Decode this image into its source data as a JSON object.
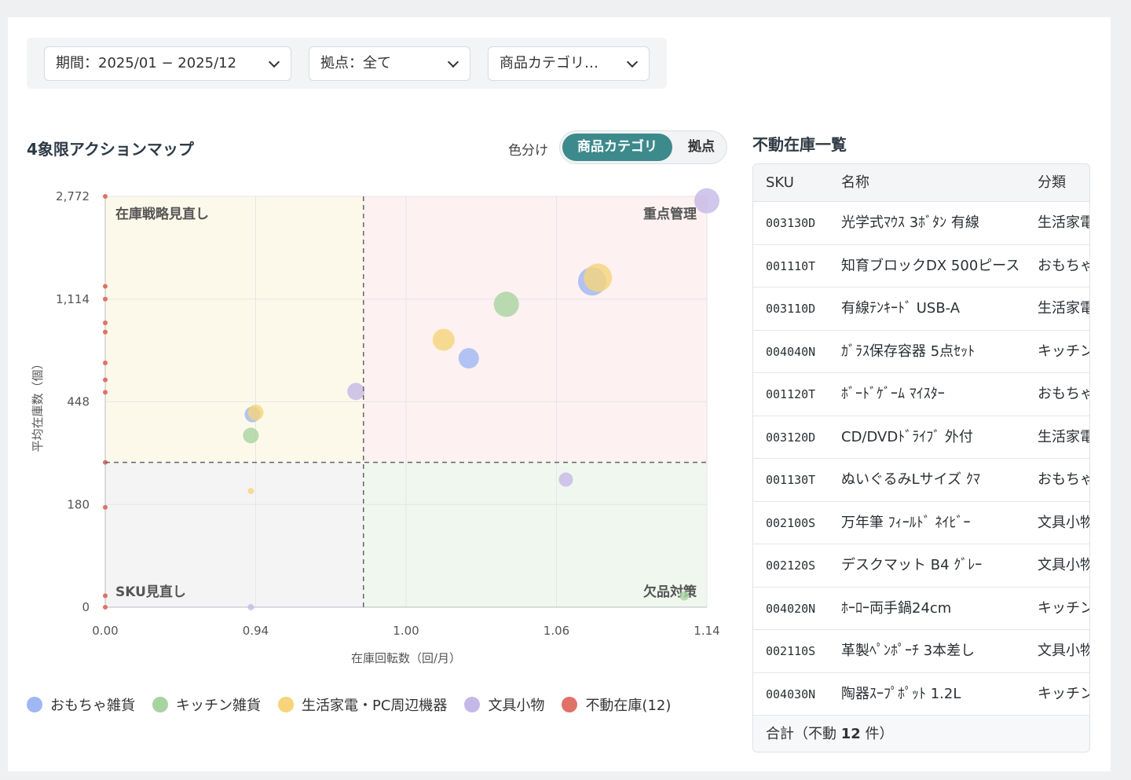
{
  "filters": {
    "period": "期間：2025/01 − 2025/12",
    "location": "拠点：全て",
    "category": "商品カテゴリ：…"
  },
  "colors": {
    "toys": "#9fb7f2",
    "kitchen": "#a7d3a0",
    "electronics": "#f5d47a",
    "stationery": "#c6b8e6",
    "dead_stock": "#e07168",
    "accent": "#3d8a8c"
  },
  "chart_header": {
    "title": "4象限アクションマップ",
    "color_caption": "色分け",
    "toggle_active": "商品カテゴリ",
    "toggle_inactive": "拠点"
  },
  "chart_data": {
    "type": "scatter",
    "xlabel": "在庫回転数（回/月）",
    "ylabel": "平均在庫数（個）",
    "x_ticks": [
      "0.00",
      "0.94",
      "1.00",
      "1.06",
      "1.14"
    ],
    "y_ticks": [
      "0",
      "180",
      "448",
      "1,114",
      "2,772"
    ],
    "y_scale": "log",
    "quadrant_labels": {
      "top_left": "在庫戦略見直し",
      "top_right": "重点管理",
      "bottom_left": "SKU見直し",
      "bottom_right": "欠品対策"
    },
    "threshold": {
      "x": 0.983,
      "y": 290
    },
    "series": [
      {
        "name": "おもちゃ雑貨",
        "color": "#9fb7f2",
        "points": [
          {
            "x": 0.92,
            "y": 415,
            "r": 10
          },
          {
            "x": 1.025,
            "y": 730,
            "r": 13
          },
          {
            "x": 1.079,
            "y": 1400,
            "r": 18
          }
        ]
      },
      {
        "name": "キッチン雑貨",
        "color": "#a7d3a0",
        "points": [
          {
            "x": 0.91,
            "y": 360,
            "r": 10
          },
          {
            "x": 1.04,
            "y": 1080,
            "r": 16
          },
          {
            "x": 1.128,
            "y": 20,
            "r": 6
          }
        ]
      },
      {
        "name": "生活家電・PC周辺機器",
        "color": "#f5d47a",
        "points": [
          {
            "x": 0.94,
            "y": 420,
            "r": 10
          },
          {
            "x": 1.015,
            "y": 850,
            "r": 14
          },
          {
            "x": 1.082,
            "y": 1460,
            "r": 18
          },
          {
            "x": 0.91,
            "y": 215,
            "r": 4
          }
        ]
      },
      {
        "name": "文具小物",
        "color": "#c6b8e6",
        "points": [
          {
            "x": 0.98,
            "y": 515,
            "r": 11
          },
          {
            "x": 1.065,
            "y": 245,
            "r": 9
          },
          {
            "x": 1.14,
            "y": 2700,
            "r": 16
          },
          {
            "x": 0.91,
            "y": 0,
            "r": 4
          }
        ]
      },
      {
        "name": "不動在庫(12)",
        "color": "#e07168",
        "points": [
          {
            "x": 0.0,
            "y": 2772
          },
          {
            "x": 0.0,
            "y": 1320
          },
          {
            "x": 0.0,
            "y": 1114
          },
          {
            "x": 0.0,
            "y": 960
          },
          {
            "x": 0.0,
            "y": 900
          },
          {
            "x": 0.0,
            "y": 700
          },
          {
            "x": 0.0,
            "y": 590
          },
          {
            "x": 0.0,
            "y": 510
          },
          {
            "x": 0.0,
            "y": 290
          },
          {
            "x": 0.0,
            "y": 175
          },
          {
            "x": 0.0,
            "y": 20
          },
          {
            "x": 0.0,
            "y": 0
          }
        ]
      }
    ],
    "legend": [
      "おもちゃ雑貨",
      "キッチン雑貨",
      "生活家電・PC周辺機器",
      "文具小物",
      "不動在庫(12)"
    ],
    "legend_position": "bottom"
  },
  "table": {
    "title": "不動在庫一覧",
    "headers": [
      "SKU",
      "名称",
      "分類"
    ],
    "rows": [
      [
        "003130D",
        "光学式ﾏｳｽ 3ﾎﾞﾀﾝ 有線",
        "生活家電・PC周辺機器"
      ],
      [
        "001110T",
        "知育ブロックDX 500ピース",
        "おもちゃ雑貨"
      ],
      [
        "003110D",
        "有線ﾃﾝｷｰﾄﾞ USB-A",
        "生活家電・PC周辺機器"
      ],
      [
        "004040N",
        "ｶﾞﾗｽ保存容器 5点ｾｯﾄ",
        "キッチン雑貨"
      ],
      [
        "001120T",
        "ﾎﾞｰﾄﾞｹﾞｰﾑ ﾏｲｽﾀｰ",
        "おもちゃ雑貨"
      ],
      [
        "003120D",
        "CD/DVDﾄﾞﾗｲﾌﾞ 外付",
        "生活家電・PC周辺機器"
      ],
      [
        "001130T",
        "ぬいぐるみLサイズ ｸﾏ",
        "おもちゃ雑貨"
      ],
      [
        "002100S",
        "万年筆 ﾌｨｰﾙﾄﾞ ﾈｲﾋﾞｰ",
        "文具小物"
      ],
      [
        "002120S",
        "デスクマット B4 ｸﾞﾚｰ",
        "文具小物"
      ],
      [
        "004020N",
        "ﾎｰﾛｰ両手鍋24cm",
        "キッチン雑貨"
      ],
      [
        "002110S",
        "革製ﾍﾟﾝﾎﾟｰﾁ 3本差し",
        "文具小物"
      ],
      [
        "004030N",
        "陶器ｽｰﾌﾟﾎﾟｯﾄ 1.2L",
        "キッチン雑貨"
      ]
    ],
    "footer_prefix": "合計（不動 ",
    "footer_count": "12",
    "footer_suffix": " 件）"
  }
}
